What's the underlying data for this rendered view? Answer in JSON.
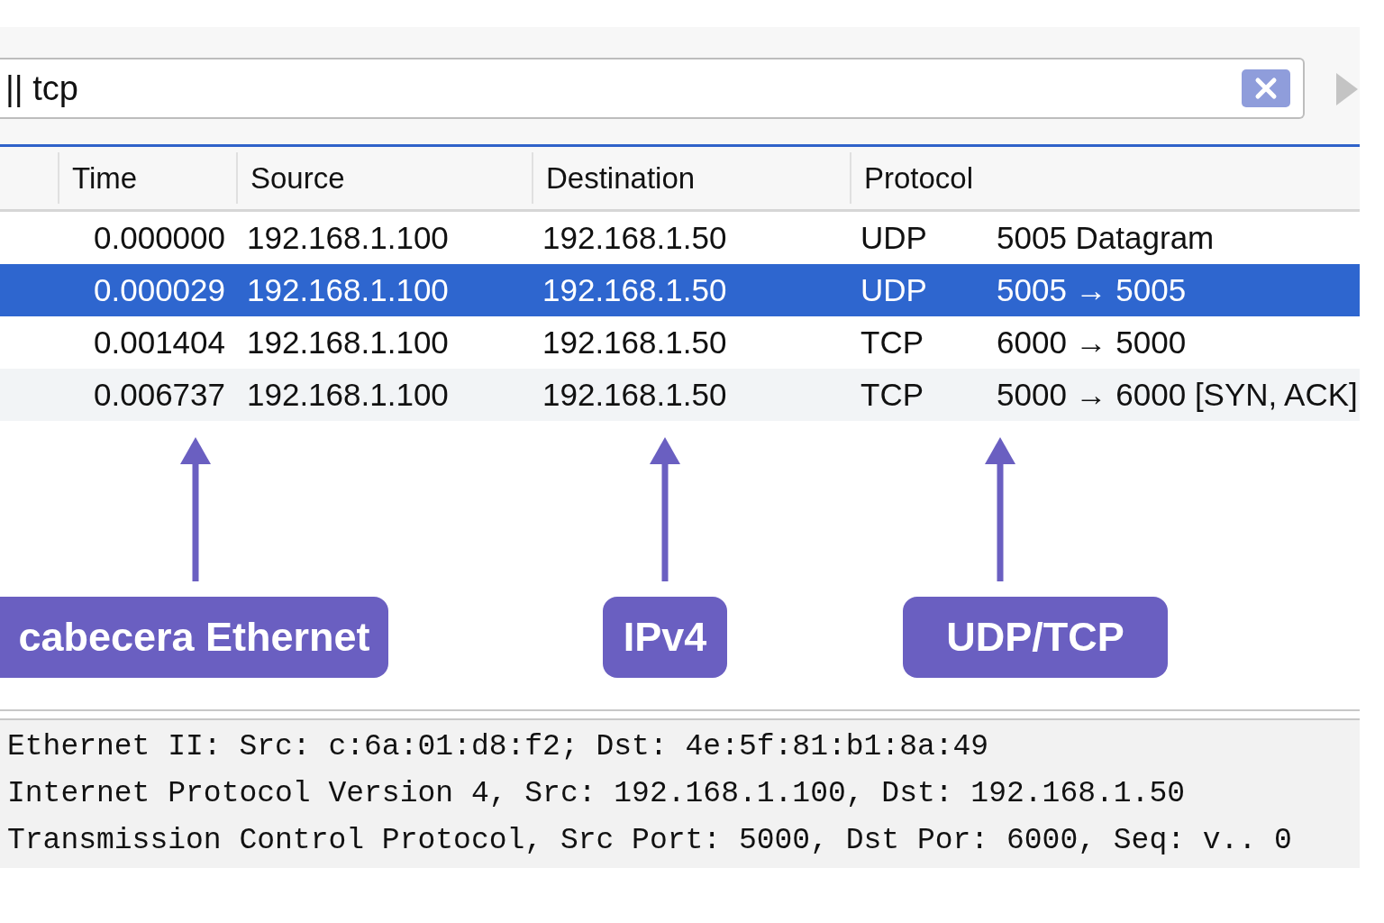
{
  "filter": {
    "value": "|| tcp"
  },
  "table": {
    "columns": [
      "Time",
      "Source",
      "Destination",
      "Protocol"
    ],
    "rows": [
      {
        "selected": false,
        "cells": [
          "0.000000",
          "192.168.1.100",
          "192.168.1.50",
          "UDP",
          "5005 Datagram"
        ]
      },
      {
        "selected": true,
        "cells": [
          "0.000029",
          "192.168.1.100",
          "192.168.1.50",
          "UDP",
          "5005 → 5005"
        ]
      },
      {
        "selected": false,
        "cells": [
          "0.001404",
          "192.168.1.100",
          "192.168.1.50",
          "TCP",
          "6000 → 5000"
        ]
      },
      {
        "selected": false,
        "cells": [
          "0.006737",
          "192.168.1.100",
          "192.168.1.50",
          "TCP",
          "5000 → 6000 [SYN, ACK]"
        ]
      }
    ]
  },
  "annotations": [
    {
      "label": "cabecera Ethernet"
    },
    {
      "label": "IPv4"
    },
    {
      "label": "UDP/TCP"
    }
  ],
  "details": [
    "Ethernet II: Src: c:6a:01:d8:f2; Dst: 4e:5f:81:b1:8a:49",
    "Internet Protocol Version 4, Src: 192.168.1.100, Dst: 192.168.1.50",
    "Transmission Control Protocol, Src Port: 5000, Dst Por: 6000, Seq: v.. 0"
  ]
}
